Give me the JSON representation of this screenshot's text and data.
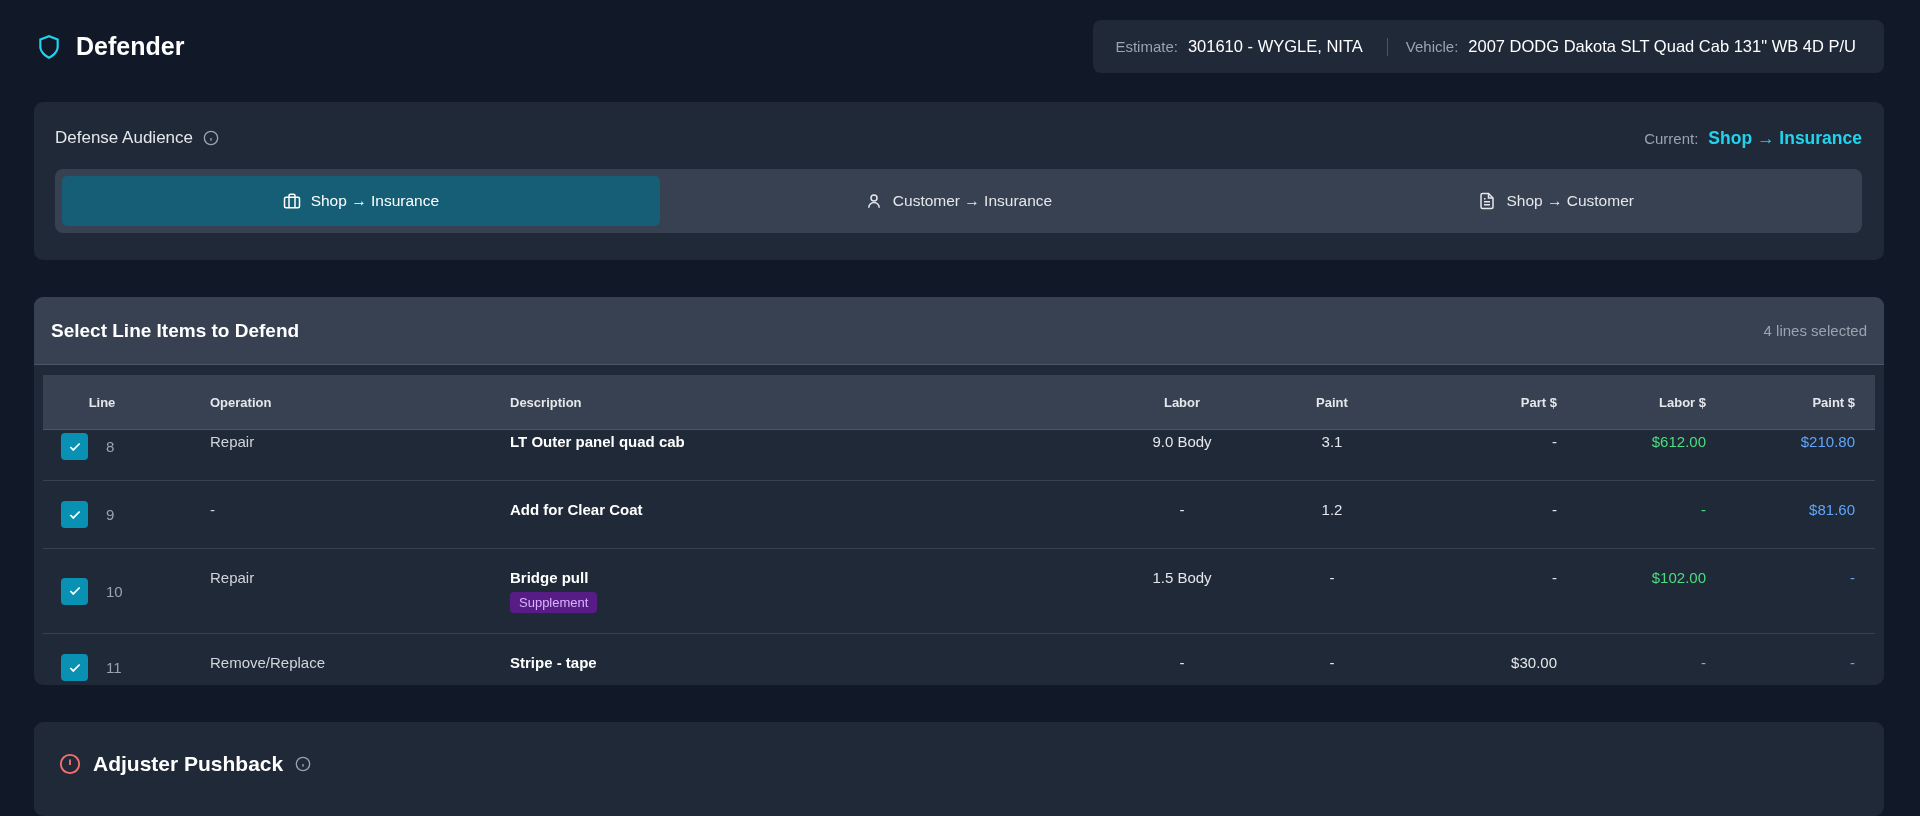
{
  "app": {
    "title": "Defender"
  },
  "estimate_info": {
    "estimate_label": "Estimate:",
    "estimate_value": "301610 - WYGLE, NITA",
    "vehicle_label": "Vehicle:",
    "vehicle_value": "2007 DODG Dakota SLT Quad Cab 131\" WB 4D P/U"
  },
  "audience": {
    "title": "Defense Audience",
    "current_label": "Current:",
    "current_value": "Shop → Insurance",
    "tabs": [
      {
        "label": "Shop → Insurance",
        "selected": true
      },
      {
        "label": "Customer → Insurance",
        "selected": false
      },
      {
        "label": "Shop → Customer",
        "selected": false
      }
    ]
  },
  "line_items": {
    "title": "Select Line Items to Defend",
    "count": "4 lines selected",
    "columns": [
      "Line",
      "Operation",
      "Description",
      "Labor",
      "Paint",
      "Part $",
      "Labor $",
      "Paint $"
    ],
    "rows": [
      {
        "checked": true,
        "line": "8",
        "operation": "Repair",
        "description": "LT Outer panel quad cab",
        "labor": "9.0 Body",
        "paint": "3.1",
        "part_cost": "-",
        "labor_cost": "$612.00",
        "paint_cost": "$210.80"
      },
      {
        "checked": true,
        "line": "9",
        "operation": "-",
        "description": "Add for Clear Coat",
        "labor": "-",
        "paint": "1.2",
        "part_cost": "-",
        "labor_cost": "-",
        "paint_cost": "$81.60"
      },
      {
        "checked": true,
        "line": "10",
        "operation": "Repair",
        "description": "Bridge pull",
        "badge": "Supplement",
        "labor": "1.5 Body",
        "paint": "-",
        "part_cost": "-",
        "labor_cost": "$102.00",
        "paint_cost": "-"
      },
      {
        "checked": true,
        "line": "11",
        "operation": "Remove/Replace",
        "description": "Stripe - tape",
        "labor": "-",
        "paint": "-",
        "part_cost": "$30.00",
        "labor_cost": "-",
        "paint_cost": "-"
      }
    ]
  },
  "pushback": {
    "title": "Adjuster Pushback"
  }
}
